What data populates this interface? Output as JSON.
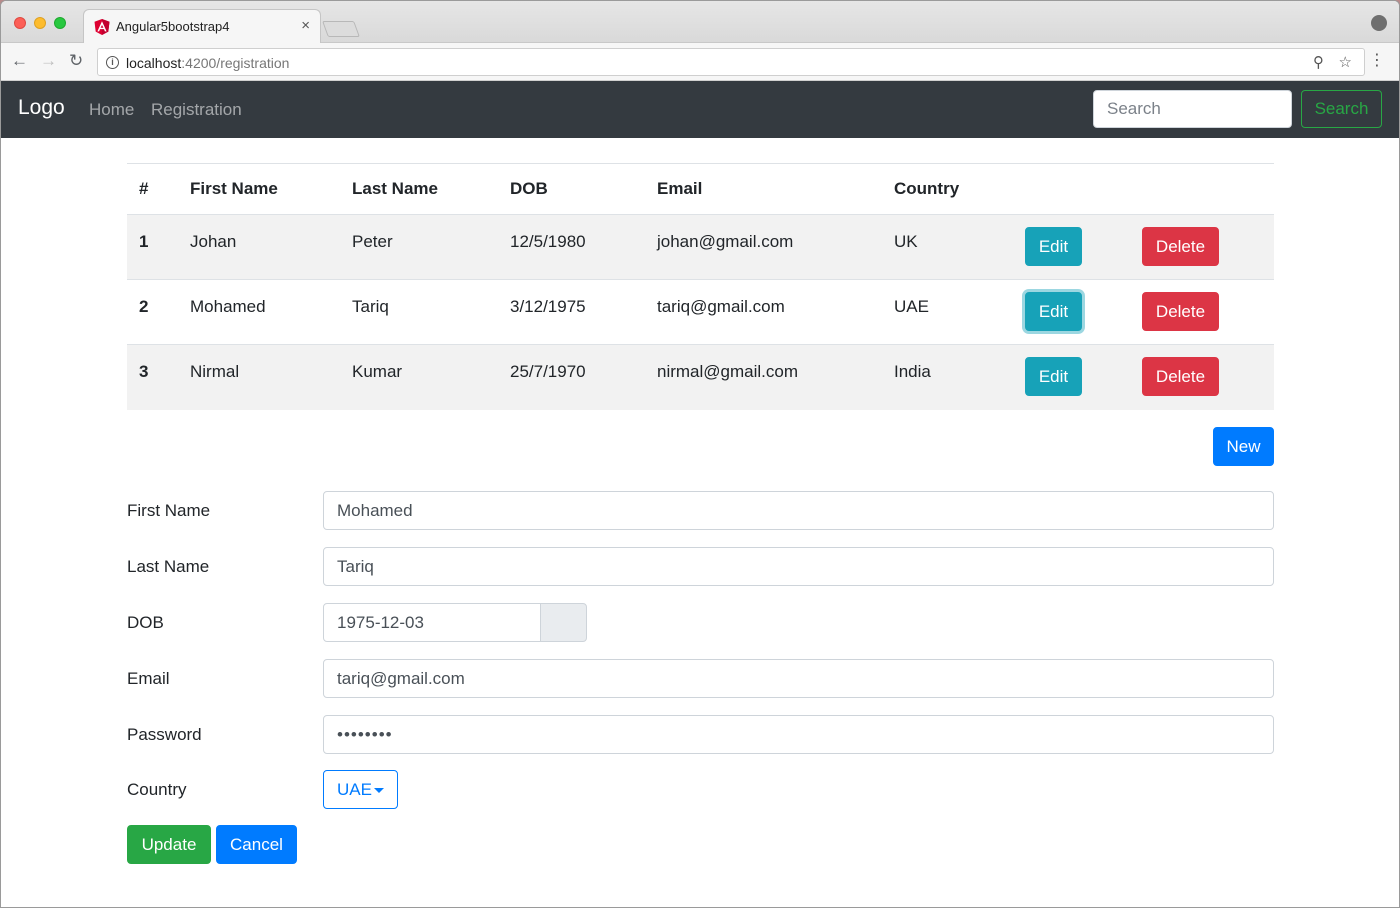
{
  "browser": {
    "tab_title": "Angular5bootstrap4",
    "tab_close": "×",
    "url_host": "localhost",
    "url_path": ":4200/registration",
    "icons": [
      "back-arrow-icon",
      "forward-arrow-icon",
      "reload-icon",
      "info-icon",
      "key-icon",
      "star-icon",
      "menu-dots-icon",
      "profile-icon"
    ]
  },
  "navbar": {
    "brand": "Logo",
    "links": [
      "Home",
      "Registration"
    ],
    "search_placeholder": "Search",
    "search_button": "Search"
  },
  "table": {
    "headers": [
      "#",
      "First Name",
      "Last Name",
      "DOB",
      "Email",
      "Country"
    ],
    "rows": [
      {
        "num": "1",
        "first": "Johan",
        "last": "Peter",
        "dob": "12/5/1980",
        "email": "johan@gmail.com",
        "country": "UK",
        "edit": "Edit",
        "delete": "Delete"
      },
      {
        "num": "2",
        "first": "Mohamed",
        "last": "Tariq",
        "dob": "3/12/1975",
        "email": "tariq@gmail.com",
        "country": "UAE",
        "edit": "Edit",
        "delete": "Delete"
      },
      {
        "num": "3",
        "first": "Nirmal",
        "last": "Kumar",
        "dob": "25/7/1970",
        "email": "nirmal@gmail.com",
        "country": "India",
        "edit": "Edit",
        "delete": "Delete"
      }
    ],
    "new_button": "New"
  },
  "form": {
    "first_name_label": "First Name",
    "first_name_value": "Mohamed",
    "last_name_label": "Last Name",
    "last_name_value": "Tariq",
    "dob_label": "DOB",
    "dob_value": "1975-12-03",
    "email_label": "Email",
    "email_value": "tariq@gmail.com",
    "password_label": "Password",
    "password_value": "••••••••",
    "country_label": "Country",
    "country_selected": "UAE",
    "update_button": "Update",
    "cancel_button": "Cancel"
  },
  "colors": {
    "navbar_bg": "#343a40",
    "success": "#28a745",
    "primary": "#007bff",
    "info": "#17a2b8",
    "danger": "#dc3545"
  }
}
